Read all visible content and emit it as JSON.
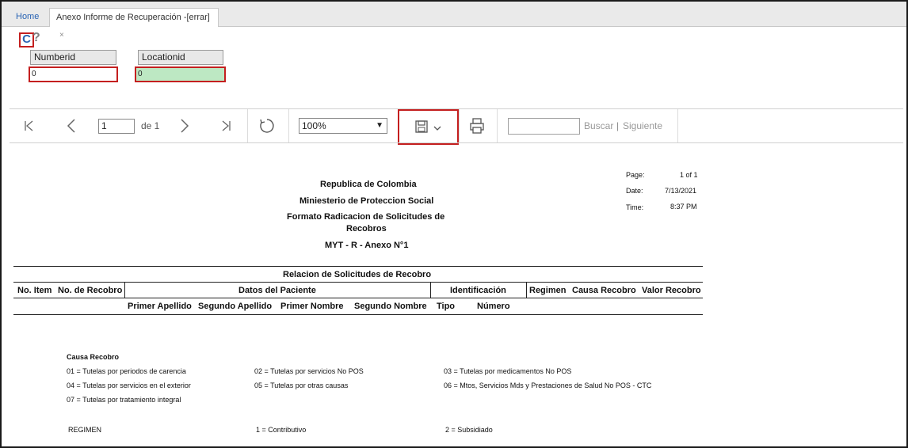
{
  "tabs": {
    "home": "Home",
    "active": "Anexo Informe de Recuperación -[errar]",
    "close": "×"
  },
  "icons": {
    "refresh": "refresh-icon",
    "help": "help-icon"
  },
  "params": {
    "numberid_label": "Numberid",
    "numberid_value": "0",
    "locationid_label": "Locationid",
    "locationid_value": "0"
  },
  "toolbar": {
    "first": "|◁",
    "prev": "‹",
    "page": "1",
    "of": "de 1",
    "next": "›",
    "last": "▷|",
    "zoom": "100%",
    "search_label": "Buscar",
    "next_label": "Siguiente"
  },
  "report": {
    "header": {
      "line1": "Republica de Colombia",
      "line2": "Miniesterio de Proteccion Social",
      "line3a": "Formato Radicacion de Solicitudes de",
      "line3b": "Recobros",
      "line4": "MYT - R - Anexo N°1"
    },
    "meta": {
      "page_label": "Page:",
      "page_value": "1 of 1",
      "date_label": "Date:",
      "date_value": "7/13/2021",
      "time_label": "Time:",
      "time_value": "8:37 PM"
    },
    "table": {
      "title": "Relacion de Solicitudes de Recobro",
      "h_item": "No. Item",
      "h_recobro": "No. de Recobro",
      "h_paciente": "Datos del Paciente",
      "h_ident": "Identificación",
      "h_regimen": "Regimen",
      "h_causa": "Causa Recobro",
      "h_valor": "Valor Recobro",
      "s_ap1": "Primer Apellido",
      "s_ap2": "Segundo Apellido",
      "s_n1": "Primer Nombre",
      "s_n2": "Segundo Nombre",
      "s_tipo": "Tipo",
      "s_num": "Número"
    },
    "legend": {
      "title": "Causa Recobro",
      "c01": "01 = Tutelas por periodos de carencia",
      "c02": "02 = Tutelas por servicios No POS",
      "c03": "03 = Tutelas por medicamentos No POS",
      "c04": "04 = Tutelas por servicios en el exterior",
      "c05": "05 = Tutelas por otras causas",
      "c06": "06 = Mtos, Servicios Mds y Prestaciones de Salud No POS - CTC",
      "c07": "07 = Tutelas por tratamiento integral",
      "regimen": "REGIMEN",
      "r1": "1 = Contributivo",
      "r2": "2 = Subsidiado"
    }
  }
}
